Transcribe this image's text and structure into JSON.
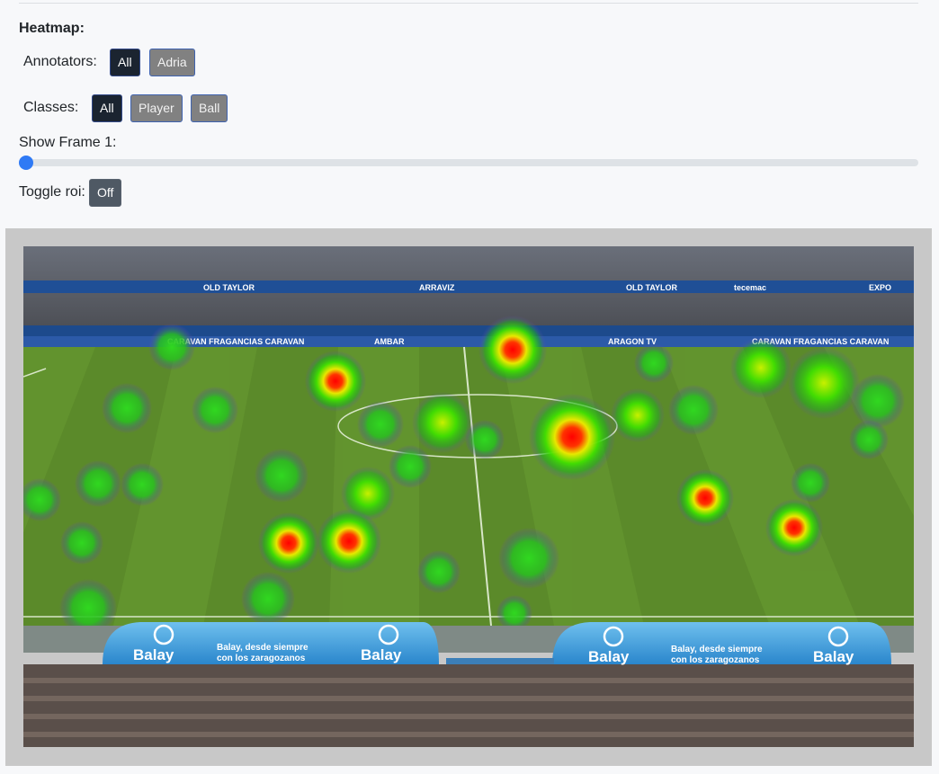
{
  "heatmap": {
    "title": "Heatmap:",
    "annotators": {
      "label": "Annotators:",
      "options": [
        "All",
        "Adria"
      ],
      "selected": "All"
    },
    "classes": {
      "label": "Classes:",
      "options": [
        "All",
        "Player",
        "Ball"
      ],
      "selected": "All"
    },
    "frame": {
      "label": "Show Frame 1:",
      "value": 1
    },
    "roi": {
      "label": "Toggle roi:",
      "button": "Off"
    }
  },
  "image": {
    "dugout_left": {
      "brand": "Balay",
      "slogan_1": "Balay, desde siempre",
      "slogan_2": "con los zaragozanos",
      "brand_2": "Balay"
    },
    "dugout_right": {
      "brand": "Balay",
      "slogan_1": "Balay, desde siempre",
      "slogan_2": "con los zaragozanos",
      "brand_2": "Balay"
    },
    "ad_boards": [
      "OLD TAYLOR",
      "ARRAVIZ",
      "OLD TAYLOR",
      "CARAVAN FRAGANCIAS CARAVAN",
      "AMBAR",
      "ARAGON TV",
      "CARAVAN FRAGANCIAS CARAVAN",
      "tecemac",
      "EXPO"
    ]
  },
  "colors": {
    "accent": "#2f7af5",
    "button_dark": "#1b2430",
    "button_grey": "#818181",
    "pitch": "#5b8a2a"
  }
}
